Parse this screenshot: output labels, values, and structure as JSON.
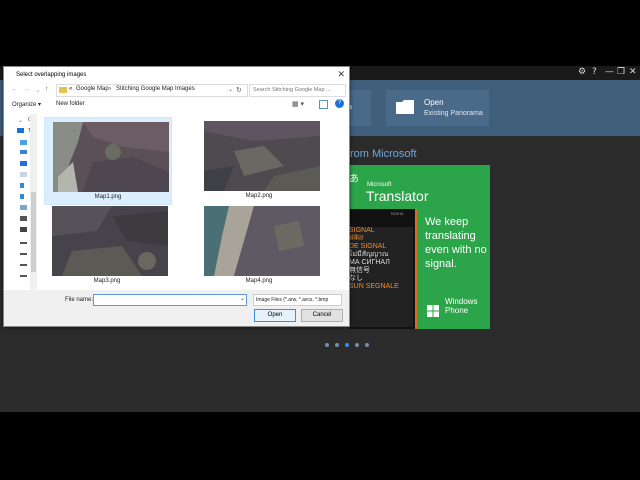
{
  "app": {
    "window_controls": [
      "⚙",
      "?",
      "—",
      "❐",
      "✕"
    ],
    "tiles": {
      "open_title": "Open",
      "open_subtitle": "Existing Panorama",
      "partial_label": "a"
    },
    "section_heading": "rom Microsoft",
    "ad": {
      "brand": "Microsoft",
      "title": "Translator",
      "tagline": "We keep translating even with no signal.",
      "phone_brand": "NOKIA",
      "phone_lines": [
        "SIGNAL",
        "संकेत",
        "DE SIGNAL",
        "ไม่มีสัญญาณ",
        "МА СИГНАЛ",
        "無信号",
        "なし",
        "SUN SEGNALE"
      ],
      "platform": "Windows Phone"
    },
    "carousel_dots": 5,
    "carousel_active": 2
  },
  "dialog": {
    "title": "Select overlapping images",
    "close_glyph": "✕",
    "breadcrumb": [
      "«",
      "Google Map",
      "›",
      "Stitching Google Map Images"
    ],
    "search_placeholder": "Search Stitching Google Map ...",
    "toolbar": {
      "organize": "Organize ▾",
      "new_folder": "New folder",
      "help": "?"
    },
    "nav_items": [
      "O",
      "Tl",
      "",
      "",
      "",
      "",
      "",
      "",
      "",
      "",
      "",
      "",
      ""
    ],
    "files": [
      {
        "name": "Map1.png",
        "selected": true
      },
      {
        "name": "Map2.png",
        "selected": false
      },
      {
        "name": "Map3.png",
        "selected": false
      },
      {
        "name": "Map4.png",
        "selected": false
      }
    ],
    "footer": {
      "file_name_label": "File name:",
      "file_name_value": "",
      "filter": "Image Files (*.arw, *.avcs, *.bmp",
      "open_button": "Open",
      "cancel_button": "Cancel"
    }
  },
  "colors": {
    "header_blue": "#3f5f7c",
    "ad_green": "#2ca44a",
    "section_text": "#6fa8dc"
  }
}
